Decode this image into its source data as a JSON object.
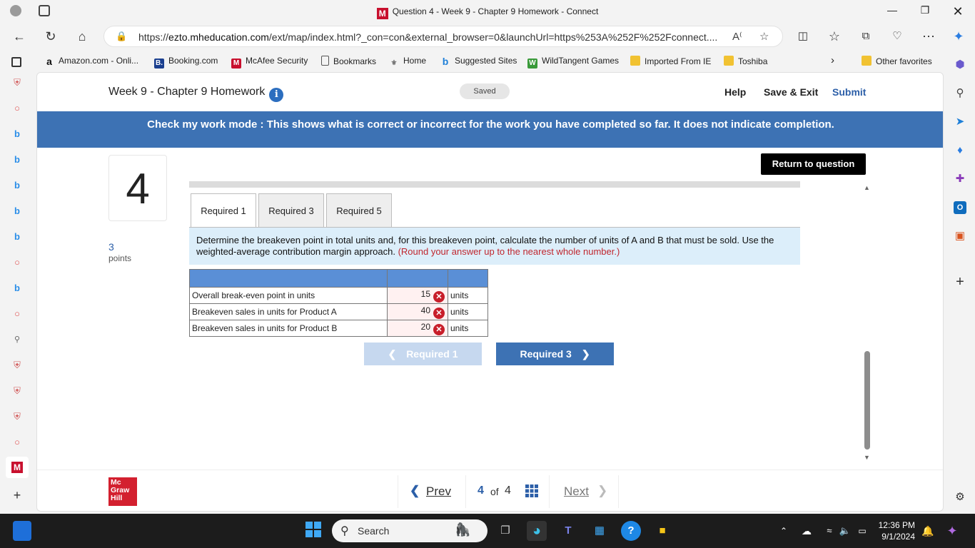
{
  "browser": {
    "window_title": "Question 4 - Week 9 - Chapter 9 Homework - Connect",
    "url_prefix": "https://",
    "url_domain": "ezto.mheducation.com",
    "url_rest": "/ext/map/index.html?_con=con&external_browser=0&launchUrl=https%253A%252F%252Fconnect....",
    "favorites": [
      {
        "label": "Amazon.com - Onli...",
        "icon": "amazon-icon"
      },
      {
        "label": "Booking.com",
        "icon": "booking-icon"
      },
      {
        "label": "McAfee Security",
        "icon": "mcafee-icon"
      },
      {
        "label": "Bookmarks",
        "icon": "page-icon"
      },
      {
        "label": "Home",
        "icon": "home-icon"
      },
      {
        "label": "Suggested Sites",
        "icon": "bing-icon"
      },
      {
        "label": "WildTangent Games",
        "icon": "wildtangent-icon"
      },
      {
        "label": "Imported From IE",
        "icon": "folder-icon"
      },
      {
        "label": "Toshiba",
        "icon": "folder-icon"
      }
    ],
    "other_favorites": "Other favorites"
  },
  "header": {
    "title": "Week 9 - Chapter 9 Homework",
    "saved": "Saved",
    "help": "Help",
    "save_exit": "Save & Exit",
    "submit": "Submit"
  },
  "banner": "Check my work mode : This shows what is correct or incorrect for the work you have completed so far. It does not indicate completion.",
  "question": {
    "number": "4",
    "points": "3",
    "points_label": "points",
    "return_label": "Return to question"
  },
  "tabs": [
    "Required 1",
    "Required 3",
    "Required 5"
  ],
  "instructions": {
    "text": "Determine the breakeven point in total units and, for this breakeven point, calculate the number of units of A and B that must be sold. Use the weighted-average contribution margin approach.",
    "note": "(Round your answer up to the nearest whole number.)"
  },
  "answers": [
    {
      "label": "Overall break-even point in units",
      "value": "15",
      "unit": "units",
      "status": "incorrect"
    },
    {
      "label": "Breakeven sales in units for Product A",
      "value": "40",
      "unit": "units",
      "status": "incorrect"
    },
    {
      "label": "Breakeven sales in units for Product B",
      "value": "20",
      "unit": "units",
      "status": "incorrect"
    }
  ],
  "nav": {
    "prev_req": "Required 1",
    "next_req": "Required 3"
  },
  "pager": {
    "prev": "Prev",
    "current": "4",
    "of": "of",
    "total": "4",
    "next": "Next"
  },
  "logo": {
    "line1": "Mc",
    "line2": "Graw",
    "line3": "Hill"
  },
  "taskbar": {
    "search": "Search",
    "time": "12:36 PM",
    "date": "9/1/2024"
  },
  "colors": {
    "accent": "#3d72b4",
    "error": "#c81e2a",
    "brand": "#d3202f"
  }
}
